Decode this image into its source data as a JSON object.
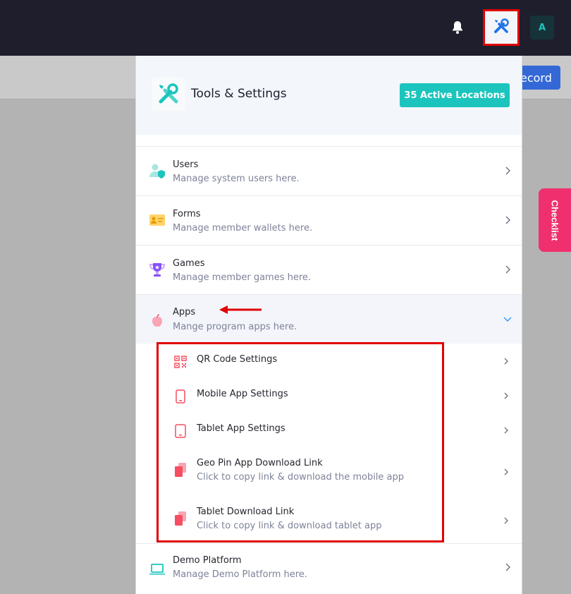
{
  "topbar": {
    "avatar_initial": "A",
    "icons": {
      "bell": "bell-icon",
      "tools": "wrench-screwdriver-icon"
    }
  },
  "background": {
    "record_button_label": "ecord",
    "checklist_label": "Checklist"
  },
  "panel": {
    "title": "Tools & Settings",
    "locations_badge": "35 Active Locations",
    "items": [
      {
        "title": "Users",
        "desc": "Manage system users here.",
        "icon": "user-shield-icon"
      },
      {
        "title": "Forms",
        "desc": "Manage member wallets here.",
        "icon": "id-card-icon"
      },
      {
        "title": "Games",
        "desc": "Manage member games here.",
        "icon": "trophy-icon"
      },
      {
        "title": "Apps",
        "desc": "Mange program apps here.",
        "icon": "apple-icon",
        "expanded": true
      }
    ],
    "apps_subitems": [
      {
        "title": "QR Code Settings",
        "icon": "qr-code-icon"
      },
      {
        "title": "Mobile App Settings",
        "icon": "mobile-icon"
      },
      {
        "title": "Tablet App Settings",
        "icon": "tablet-icon"
      },
      {
        "title": "Geo Pin App Download Link",
        "desc": "Click to copy link & download the mobile app",
        "icon": "copy-icon"
      },
      {
        "title": "Tablet Download Link",
        "desc": "Click to copy link & download tablet app",
        "icon": "copy-icon"
      }
    ],
    "demo": {
      "title": "Demo Platform",
      "desc": "Manage Demo Platform here.",
      "icon": "laptop-icon"
    }
  },
  "colors": {
    "accent": "#1bc5bd",
    "highlight": "#e00000",
    "checklist": "#f0306e",
    "apps_icon": "#f64e60"
  }
}
